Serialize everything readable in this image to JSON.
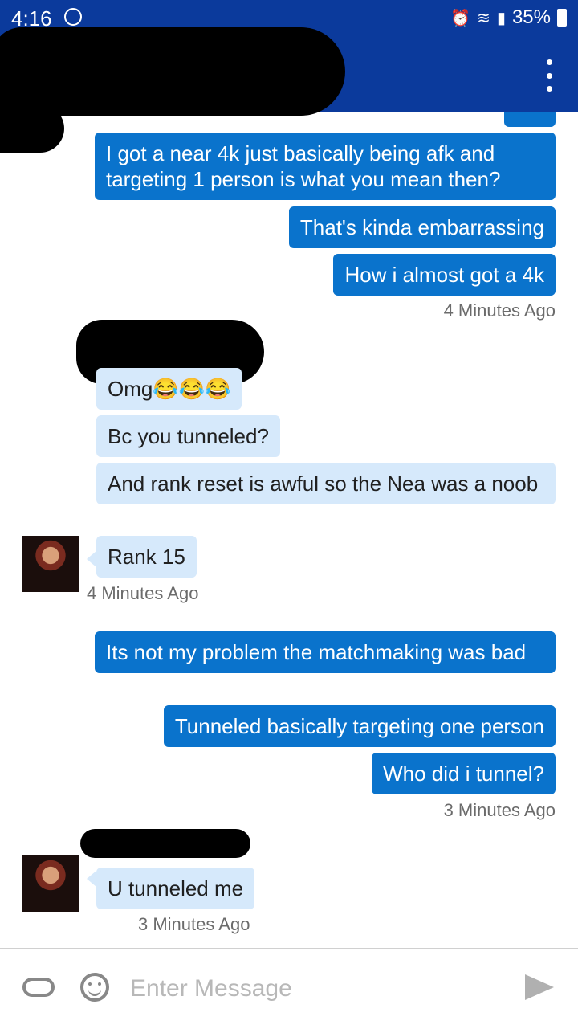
{
  "status": {
    "time": "4:16",
    "battery": "35%"
  },
  "messages": {
    "m1": "I got a near 4k just basically being afk and targeting 1 person is what you mean then?",
    "m2": "That's kinda embarrassing",
    "m3": "How i almost got a 4k",
    "t1": "4 Minutes Ago",
    "m4": "Omg😂😂😂",
    "m5": "Bc you tunneled?",
    "m6": "And rank reset is awful so the Nea was a noob",
    "m7": "Rank 15",
    "t2": "4 Minutes Ago",
    "m8": "Its not my problem the matchmaking was bad",
    "m9": "Tunneled basically targeting one person",
    "m10": "Who did i tunnel?",
    "t3": "3 Minutes Ago",
    "m11": "U tunneled me",
    "t4": "3 Minutes Ago"
  },
  "input": {
    "placeholder": "Enter Message"
  },
  "colors": {
    "header": "#0b3a9c",
    "outgoing": "#0a73cc",
    "incoming": "#d6e9fb"
  },
  "icons": [
    "messenger-icon",
    "alarm-icon",
    "wifi-icon",
    "signal-icon",
    "battery-icon",
    "more-vert-icon",
    "attach-icon",
    "emoji-icon",
    "send-icon"
  ]
}
